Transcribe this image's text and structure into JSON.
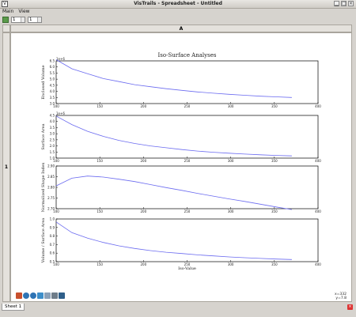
{
  "window": {
    "title": "VisTrails - Spreadsheet - Untitled"
  },
  "menu": {
    "items": [
      "Main",
      "View"
    ]
  },
  "toolbar": {
    "spin1": "1",
    "spin2": "1"
  },
  "sheet": {
    "column_header": "A",
    "row_header": "1",
    "tab": "Sheet 1"
  },
  "status": {
    "x": "x=332",
    "y": "y=7.8"
  },
  "chart_data": {
    "type": "line",
    "title": "Iso-Surface Analyses",
    "xlabel": "Iso-Value",
    "xlim": [
      100,
      400
    ],
    "x_ticks": [
      "100",
      "150",
      "200",
      "250",
      "300",
      "350",
      "400"
    ],
    "panels": [
      {
        "ylabel": "Enclosed Volume",
        "offset_label": "1e+6",
        "yticks": [
          "3.0",
          "3.5",
          "4.0",
          "4.5",
          "5.0",
          "5.5",
          "6.0",
          "6.5"
        ],
        "ylim": [
          3.0,
          6.5
        ],
        "x": [
          100,
          118,
          136,
          154,
          172,
          190,
          208,
          226,
          244,
          262,
          280,
          298,
          316,
          334,
          352,
          370
        ],
        "y": [
          6.6,
          5.85,
          5.45,
          5.05,
          4.8,
          4.55,
          4.38,
          4.22,
          4.08,
          3.95,
          3.85,
          3.76,
          3.68,
          3.6,
          3.55,
          3.5
        ]
      },
      {
        "ylabel": "Surface Area",
        "offset_label": "1e+6",
        "yticks": [
          "1.0",
          "1.5",
          "2.0",
          "2.5",
          "3.0",
          "3.5",
          "4.0",
          "4.5"
        ],
        "ylim": [
          1.0,
          4.5
        ],
        "x": [
          100,
          118,
          136,
          154,
          172,
          190,
          208,
          226,
          244,
          262,
          280,
          298,
          316,
          334,
          352,
          370
        ],
        "y": [
          4.45,
          3.75,
          3.2,
          2.78,
          2.45,
          2.2,
          2.0,
          1.85,
          1.7,
          1.58,
          1.48,
          1.4,
          1.33,
          1.27,
          1.22,
          1.18
        ]
      },
      {
        "ylabel": "Normalized Shape Index",
        "yticks": [
          "2.70",
          "2.75",
          "2.80",
          "2.85",
          "2.90"
        ],
        "ylim": [
          2.7,
          2.9
        ],
        "x": [
          100,
          118,
          136,
          154,
          172,
          190,
          208,
          226,
          244,
          262,
          280,
          298,
          316,
          334,
          352,
          370
        ],
        "y": [
          2.807,
          2.843,
          2.853,
          2.848,
          2.838,
          2.827,
          2.813,
          2.799,
          2.786,
          2.772,
          2.759,
          2.746,
          2.734,
          2.721,
          2.708,
          2.696
        ]
      },
      {
        "ylabel": "Volume / Surface Area",
        "yticks": [
          "0.5",
          "0.6",
          "0.7",
          "0.8",
          "0.9",
          "1.0"
        ],
        "ylim": [
          0.5,
          1.0
        ],
        "x": [
          100,
          118,
          136,
          154,
          172,
          190,
          208,
          226,
          244,
          262,
          280,
          298,
          316,
          334,
          352,
          370
        ],
        "y": [
          0.965,
          0.84,
          0.775,
          0.725,
          0.685,
          0.655,
          0.63,
          0.61,
          0.595,
          0.58,
          0.568,
          0.556,
          0.546,
          0.538,
          0.531,
          0.525
        ]
      }
    ]
  }
}
